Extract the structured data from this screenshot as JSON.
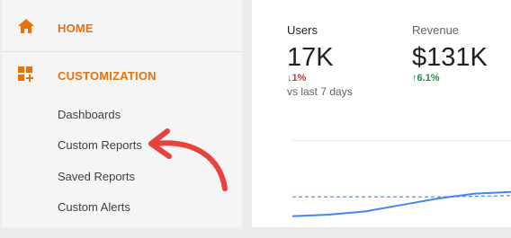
{
  "sidebar": {
    "home": {
      "label": "HOME",
      "icon": "home-icon"
    },
    "customization": {
      "label": "CUSTOMIZATION",
      "icon": "customization-icon",
      "items": [
        {
          "label": "Dashboards"
        },
        {
          "label": "Custom Reports"
        },
        {
          "label": "Saved Reports"
        },
        {
          "label": "Custom Alerts"
        }
      ]
    }
  },
  "metrics": [
    {
      "label": "Users",
      "value": "17K",
      "change": "1%",
      "direction": "down",
      "comparison": "vs last 7 days"
    },
    {
      "label": "Revenue",
      "value": "$131K",
      "change": "6.1%",
      "direction": "up"
    }
  ],
  "colors": {
    "accent": "#e8710a",
    "down": "#d93025",
    "up": "#1e8e3e",
    "series": "#4285f4",
    "annotation_arrow": "#e8423f"
  },
  "chart_data": {
    "type": "line",
    "series": [
      {
        "style": "solid",
        "values": [
          0.2,
          0.25,
          0.35,
          0.55,
          0.75,
          0.9,
          0.95
        ]
      },
      {
        "style": "dashed",
        "values": [
          0.8,
          0.8,
          0.8,
          0.8,
          0.8,
          0.82,
          0.84
        ]
      }
    ],
    "ylim": [
      0,
      1
    ]
  }
}
